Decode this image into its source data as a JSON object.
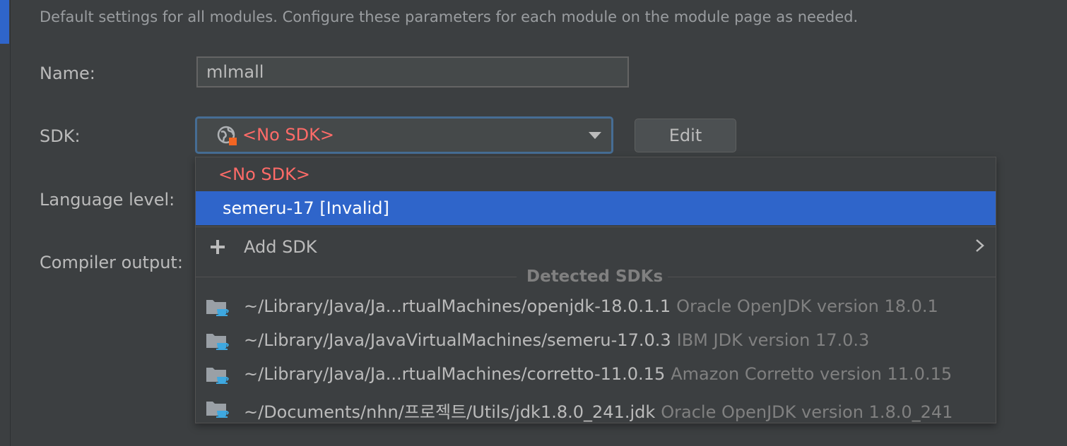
{
  "description": "Default settings for all modules. Configure these parameters for each module on the module page as needed.",
  "form": {
    "name_label": "Name:",
    "name_value": "mlmall",
    "sdk_label": "SDK:",
    "sdk_value": "<No SDK>",
    "edit_label": "Edit",
    "language_level_label": "Language level:",
    "compiler_output_label": "Compiler output:"
  },
  "dropdown": {
    "no_sdk": "<No SDK>",
    "selected": "semeru-17 [Invalid]",
    "add_sdk": "Add SDK",
    "section_title": "Detected SDKs",
    "detected": [
      {
        "path": "~/Library/Java/Ja...rtualMachines/openjdk-18.0.1.1",
        "version": "Oracle OpenJDK version 18.0.1"
      },
      {
        "path": "~/Library/Java/JavaVirtualMachines/semeru-17.0.3",
        "version": "IBM JDK version 17.0.3"
      },
      {
        "path": "~/Library/Java/Ja...rtualMachines/corretto-11.0.15",
        "version": "Amazon Corretto version 11.0.15"
      },
      {
        "path": "~/Documents/nhn/프로젝트/Utils/jdk1.8.0_241.jdk",
        "version": "Oracle OpenJDK version 1.8.0_241"
      }
    ]
  },
  "icons": {
    "sdk": "globe-icon",
    "add": "plus-icon",
    "submenu": "chevron-right-icon",
    "folder": "jdk-folder-icon"
  },
  "colors": {
    "background": "#3c3f41",
    "selection": "#2f65ca",
    "error_text": "#ff6b68",
    "muted_text": "#808080",
    "focus_border": "#466d94",
    "jdk_cup": "#3ea8e0"
  }
}
